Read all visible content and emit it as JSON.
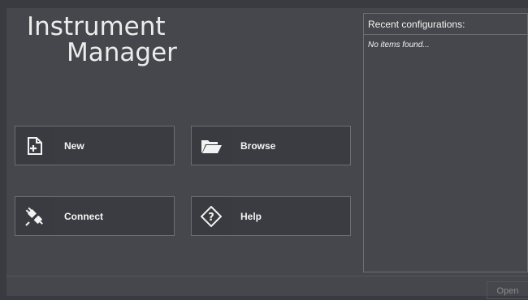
{
  "app": {
    "title_line1": "Instrument",
    "title_line2": "Manager"
  },
  "tiles": [
    {
      "label": "New",
      "icon": "new-file-icon"
    },
    {
      "label": "Browse",
      "icon": "folder-open-icon"
    },
    {
      "label": "Connect",
      "icon": "plug-icon"
    },
    {
      "label": "Help",
      "icon": "help-diamond-icon"
    }
  ],
  "recent": {
    "header": "Recent configurations:",
    "empty_text": "No items found..."
  },
  "footer": {
    "open_label": "Open"
  }
}
